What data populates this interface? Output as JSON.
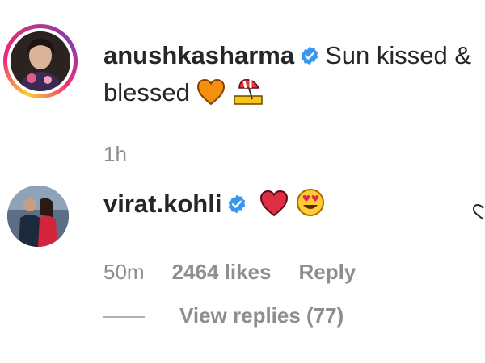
{
  "post": {
    "username": "anushkasharma",
    "caption_line1": "Sun kissed &",
    "caption_line2": "blessed",
    "time": "1h"
  },
  "comment": {
    "username": "virat.kohli",
    "time": "50m",
    "likes": "2464 likes",
    "reply_label": "Reply",
    "view_replies": "View replies (77)"
  },
  "colors": {
    "verified_blue": "#3897f0",
    "meta_gray": "#8e8e8e",
    "text": "#262626",
    "heart_orange": "#f4900c",
    "heart_red": "#dd2e44"
  }
}
